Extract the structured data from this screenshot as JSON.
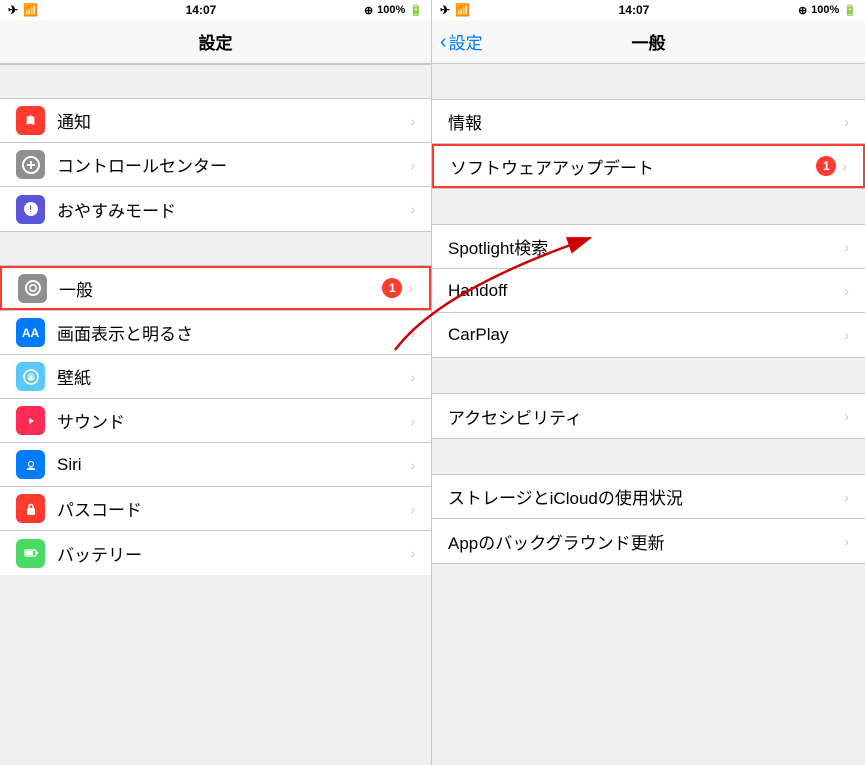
{
  "left_panel": {
    "status": {
      "time": "14:07",
      "battery": "100%"
    },
    "title": "設定",
    "items": [
      {
        "id": "notification",
        "label": "通知",
        "icon_color": "icon-red",
        "icon_char": "🔔",
        "badge": null,
        "highlighted": false
      },
      {
        "id": "control-center",
        "label": "コントロールセンター",
        "icon_color": "icon-gray",
        "icon_char": "⊕",
        "badge": null,
        "highlighted": false
      },
      {
        "id": "do-not-disturb",
        "label": "おやすみモード",
        "icon_color": "icon-blue-dark",
        "icon_char": "🌙",
        "badge": null,
        "highlighted": false
      },
      {
        "id": "general",
        "label": "一般",
        "icon_color": "icon-gray",
        "icon_char": "⚙",
        "badge": "1",
        "highlighted": true
      },
      {
        "id": "display",
        "label": "画面表示と明るさ",
        "icon_color": "icon-blue",
        "icon_char": "AA",
        "badge": null,
        "highlighted": false
      },
      {
        "id": "wallpaper",
        "label": "壁紙",
        "icon_color": "icon-teal",
        "icon_char": "✿",
        "badge": null,
        "highlighted": false
      },
      {
        "id": "sounds",
        "label": "サウンド",
        "icon_color": "icon-pink",
        "icon_char": "🔊",
        "badge": null,
        "highlighted": false
      },
      {
        "id": "siri",
        "label": "Siri",
        "icon_color": "icon-blue",
        "icon_char": "◉",
        "badge": null,
        "highlighted": false
      },
      {
        "id": "passcode",
        "label": "パスコード",
        "icon_color": "icon-red",
        "icon_char": "🔒",
        "badge": null,
        "highlighted": false
      },
      {
        "id": "battery",
        "label": "バッテリー",
        "icon_color": "icon-green",
        "icon_char": "▮",
        "badge": null,
        "highlighted": false
      }
    ]
  },
  "right_panel": {
    "status": {
      "time": "14:07",
      "battery": "100%"
    },
    "back_label": "設定",
    "title": "一般",
    "sections": [
      {
        "items": [
          {
            "id": "info",
            "label": "情報",
            "badge": null,
            "highlighted": false
          },
          {
            "id": "software-update",
            "label": "ソフトウェアアップデート",
            "badge": "1",
            "highlighted": true
          }
        ]
      },
      {
        "items": [
          {
            "id": "spotlight",
            "label": "Spotlight検索",
            "badge": null,
            "highlighted": false
          },
          {
            "id": "handoff",
            "label": "Handoff",
            "badge": null,
            "highlighted": false
          },
          {
            "id": "carplay",
            "label": "CarPlay",
            "badge": null,
            "highlighted": false
          }
        ]
      },
      {
        "items": [
          {
            "id": "accessibility",
            "label": "アクセシビリティ",
            "badge": null,
            "highlighted": false
          }
        ]
      },
      {
        "items": [
          {
            "id": "storage",
            "label": "ストレージとiCloudの使用状況",
            "badge": null,
            "highlighted": false
          },
          {
            "id": "background-app",
            "label": "Appのバックグラウンド更新",
            "badge": null,
            "highlighted": false
          }
        ]
      }
    ]
  }
}
